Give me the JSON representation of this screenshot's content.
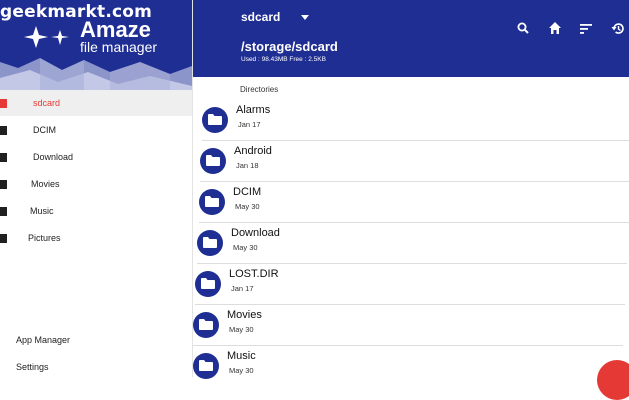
{
  "watermark": "geekmarkt.com",
  "brand": {
    "title": "Amaze",
    "subtitle": "file manager"
  },
  "sidebar": {
    "items": [
      {
        "label": "sdcard",
        "active": true
      },
      {
        "label": "DCIM",
        "active": false
      },
      {
        "label": "Download",
        "active": false
      },
      {
        "label": "Movies",
        "active": false
      },
      {
        "label": "Music",
        "active": false
      },
      {
        "label": "Pictures",
        "active": false
      }
    ],
    "app_manager": "App Manager",
    "settings": "Settings"
  },
  "appbar": {
    "title": "sdcard",
    "path": "/storage/sdcard",
    "usage": "Used : 98.43MB Free : 2.5KB",
    "icons": [
      "search-icon",
      "home-icon",
      "sort-icon",
      "history-icon"
    ]
  },
  "content": {
    "section_label": "Directories",
    "files": [
      {
        "name": "Alarms",
        "date": "Jan 17"
      },
      {
        "name": "Android",
        "date": "Jan 18"
      },
      {
        "name": "DCIM",
        "date": "May 30"
      },
      {
        "name": "Download",
        "date": "May 30"
      },
      {
        "name": "LOST.DIR",
        "date": "Jan 17"
      },
      {
        "name": "Movies",
        "date": "May 30"
      },
      {
        "name": "Music",
        "date": "May 30"
      }
    ]
  },
  "colors": {
    "primary": "#1f2e93",
    "accent": "#e53935"
  }
}
